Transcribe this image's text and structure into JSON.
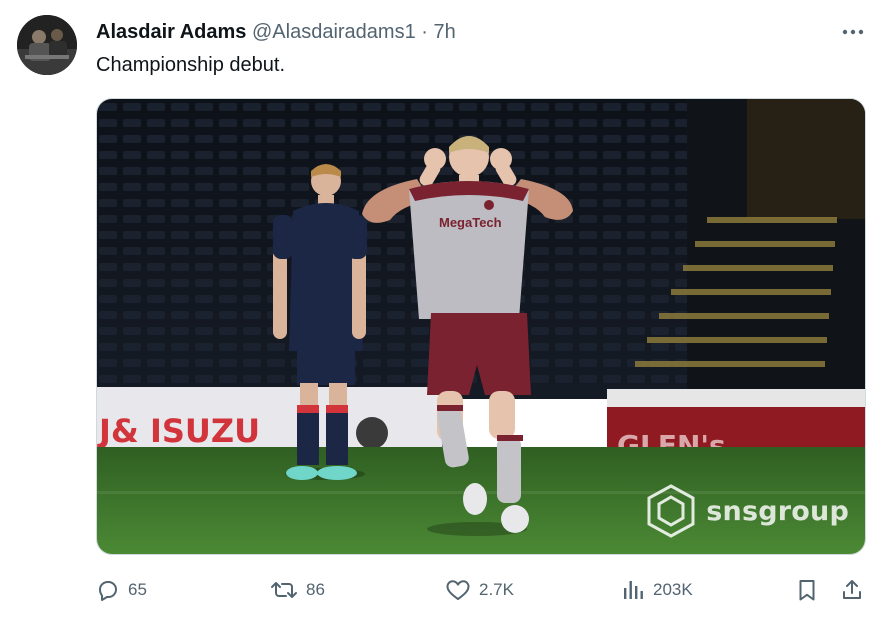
{
  "tweet": {
    "author": {
      "display_name": "Alasdair Adams",
      "handle": "@Alasdairadams1",
      "separator": "·",
      "time": "7h"
    },
    "text": "Championship debut.",
    "media": {
      "sponsor_board_text": "J& ISUZU",
      "sponsor_board_right_text": "GLEN's",
      "shirt_sponsor": "MegaTech",
      "watermark": "snsgroup"
    },
    "actions": {
      "replies": "65",
      "reposts": "86",
      "likes": "2.7K",
      "views": "203K"
    }
  },
  "icons": {
    "more": "more-horizontal-icon",
    "reply": "reply-icon",
    "repost": "repost-icon",
    "like": "heart-icon",
    "views": "views-icon",
    "bookmark": "bookmark-icon",
    "share": "share-icon"
  },
  "colors": {
    "text_primary": "#0f1419",
    "text_secondary": "#536471",
    "pitch": "#3f7a2c",
    "home_kit": "#1c2745",
    "away_shorts": "#7a2230"
  }
}
